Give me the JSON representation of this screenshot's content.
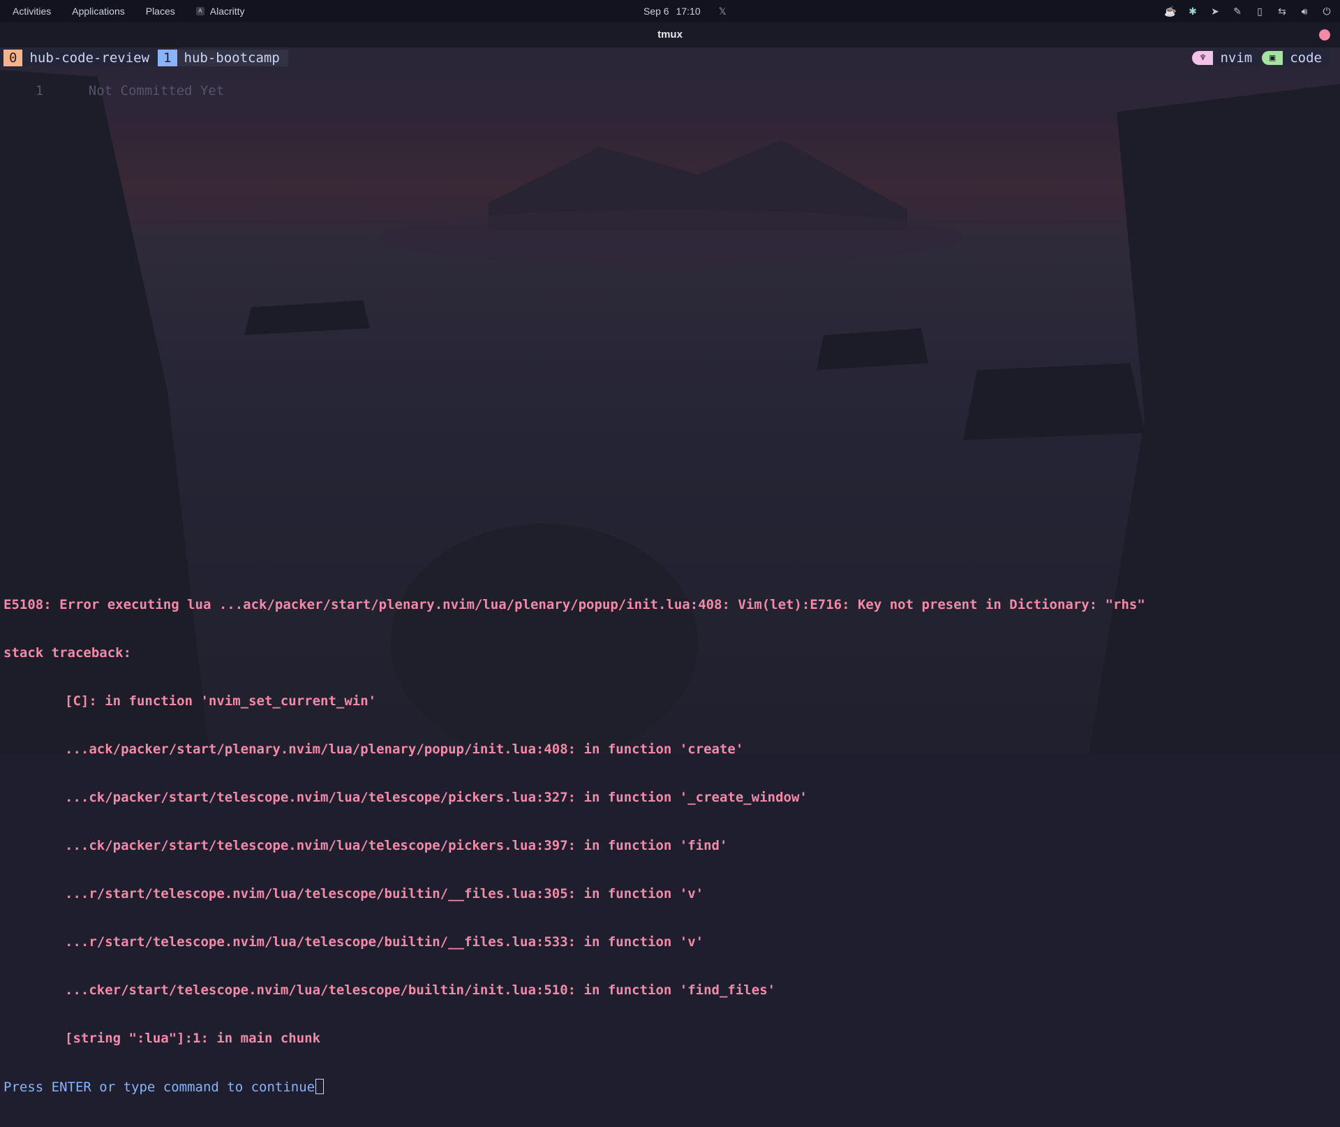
{
  "topbar": {
    "activities": "Activities",
    "applications": "Applications",
    "places": "Places",
    "app_name": "Alacritty",
    "app_icon_letter": "A",
    "date": "Sep 6",
    "time": "17:10"
  },
  "window": {
    "title": "tmux"
  },
  "tmux": {
    "windows": [
      {
        "index": "0",
        "name": "hub-code-review"
      },
      {
        "index": "1",
        "name": "hub-bootcamp"
      }
    ],
    "status_right": [
      {
        "icon": "vim-icon",
        "label": "nvim"
      },
      {
        "icon": "terminal-icon",
        "label": "code"
      }
    ]
  },
  "editor": {
    "line_number": "1",
    "blame_text": "Not Committed Yet"
  },
  "error": {
    "lines": [
      "E5108: Error executing lua ...ack/packer/start/plenary.nvim/lua/plenary/popup/init.lua:408: Vim(let):E716: Key not present in Dictionary: \"rhs\"",
      "stack traceback:"
    ],
    "traceback": [
      "[C]: in function 'nvim_set_current_win'",
      "...ack/packer/start/plenary.nvim/lua/plenary/popup/init.lua:408: in function 'create'",
      "...ck/packer/start/telescope.nvim/lua/telescope/pickers.lua:327: in function '_create_window'",
      "...ck/packer/start/telescope.nvim/lua/telescope/pickers.lua:397: in function 'find'",
      "...r/start/telescope.nvim/lua/telescope/builtin/__files.lua:305: in function 'v'",
      "...r/start/telescope.nvim/lua/telescope/builtin/__files.lua:533: in function 'v'",
      "...cker/start/telescope.nvim/lua/telescope/builtin/init.lua:510: in function 'find_files'",
      "[string \":lua\"]:1: in main chunk"
    ],
    "prompt": "Press ENTER or type command to continue"
  },
  "colors": {
    "error": "#f38ba8",
    "prompt": "#89b4fa",
    "tab_active": "#89b4fa",
    "tab_inactive": "#fab387",
    "record_dot": "#f38ba8"
  }
}
